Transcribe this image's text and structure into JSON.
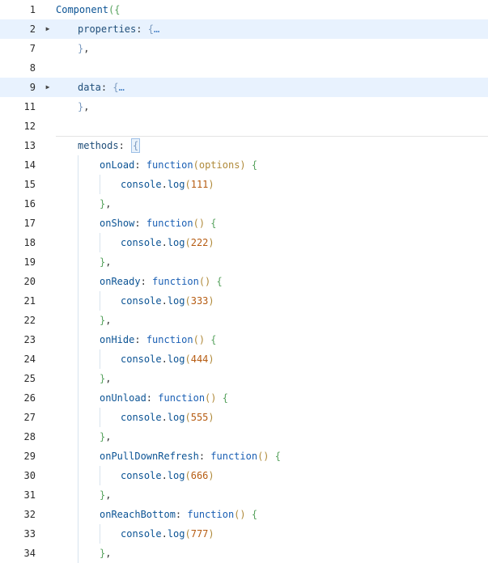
{
  "lines": [
    {
      "n": "1",
      "fold": false,
      "hl": false,
      "tokens": [
        {
          "t": "Component",
          "c": "tok-ident"
        },
        {
          "t": "({",
          "c": "tok-brace-a"
        }
      ]
    },
    {
      "n": "2",
      "fold": true,
      "hl": true,
      "indent": 1,
      "tokens": [
        {
          "t": "properties",
          "c": "tok-prop"
        },
        {
          "t": ": ",
          "c": "tok-punc"
        },
        {
          "t": "{",
          "c": "tok-brace-b"
        },
        {
          "t": "…",
          "c": "tok-ell"
        }
      ]
    },
    {
      "n": "7",
      "fold": false,
      "hl": false,
      "indent": 1,
      "tokens": [
        {
          "t": "}",
          "c": "tok-brace-b"
        },
        {
          "t": ",",
          "c": "tok-punc"
        }
      ]
    },
    {
      "n": "8",
      "fold": false,
      "hl": false,
      "tokens": []
    },
    {
      "n": "9",
      "fold": true,
      "hl": true,
      "indent": 1,
      "tokens": [
        {
          "t": "data",
          "c": "tok-prop"
        },
        {
          "t": ": ",
          "c": "tok-punc"
        },
        {
          "t": "{",
          "c": "tok-brace-b"
        },
        {
          "t": "…",
          "c": "tok-ell"
        }
      ]
    },
    {
      "n": "11",
      "fold": false,
      "hl": false,
      "indent": 1,
      "tokens": [
        {
          "t": "}",
          "c": "tok-brace-b"
        },
        {
          "t": ",",
          "c": "tok-punc"
        }
      ]
    },
    {
      "n": "12",
      "fold": false,
      "hl": false,
      "tokens": []
    },
    {
      "n": "13",
      "fold": false,
      "hl": false,
      "indent": 1,
      "tokens": [
        {
          "t": "methods",
          "c": "tok-prop"
        },
        {
          "t": ": ",
          "c": "tok-punc"
        },
        {
          "t": "{",
          "c": "tok-brace-b",
          "box": true
        }
      ]
    },
    {
      "n": "14",
      "fold": false,
      "hl": false,
      "indent": 2,
      "tokens": [
        {
          "t": "onLoad",
          "c": "tok-ident"
        },
        {
          "t": ": ",
          "c": "tok-punc"
        },
        {
          "t": "function",
          "c": "tok-kw"
        },
        {
          "t": "(",
          "c": "tok-brace-c"
        },
        {
          "t": "options",
          "c": "tok-param"
        },
        {
          "t": ")",
          "c": "tok-brace-c"
        },
        {
          "t": " {",
          "c": "tok-brace-a"
        }
      ]
    },
    {
      "n": "15",
      "fold": false,
      "hl": false,
      "indent": 3,
      "tokens": [
        {
          "t": "console",
          "c": "tok-ident"
        },
        {
          "t": ".",
          "c": "tok-punc"
        },
        {
          "t": "log",
          "c": "tok-ident"
        },
        {
          "t": "(",
          "c": "tok-brace-c"
        },
        {
          "t": "111",
          "c": "tok-num"
        },
        {
          "t": ")",
          "c": "tok-brace-c"
        }
      ]
    },
    {
      "n": "16",
      "fold": false,
      "hl": false,
      "indent": 2,
      "tokens": [
        {
          "t": "}",
          "c": "tok-brace-a"
        },
        {
          "t": ",",
          "c": "tok-punc"
        }
      ]
    },
    {
      "n": "17",
      "fold": false,
      "hl": false,
      "indent": 2,
      "tokens": [
        {
          "t": "onShow",
          "c": "tok-ident"
        },
        {
          "t": ": ",
          "c": "tok-punc"
        },
        {
          "t": "function",
          "c": "tok-kw"
        },
        {
          "t": "()",
          "c": "tok-brace-c"
        },
        {
          "t": " {",
          "c": "tok-brace-a"
        }
      ]
    },
    {
      "n": "18",
      "fold": false,
      "hl": false,
      "indent": 3,
      "tokens": [
        {
          "t": "console",
          "c": "tok-ident"
        },
        {
          "t": ".",
          "c": "tok-punc"
        },
        {
          "t": "log",
          "c": "tok-ident"
        },
        {
          "t": "(",
          "c": "tok-brace-c"
        },
        {
          "t": "222",
          "c": "tok-num"
        },
        {
          "t": ")",
          "c": "tok-brace-c"
        }
      ]
    },
    {
      "n": "19",
      "fold": false,
      "hl": false,
      "indent": 2,
      "tokens": [
        {
          "t": "}",
          "c": "tok-brace-a"
        },
        {
          "t": ",",
          "c": "tok-punc"
        }
      ]
    },
    {
      "n": "20",
      "fold": false,
      "hl": false,
      "indent": 2,
      "tokens": [
        {
          "t": "onReady",
          "c": "tok-ident"
        },
        {
          "t": ": ",
          "c": "tok-punc"
        },
        {
          "t": "function",
          "c": "tok-kw"
        },
        {
          "t": "()",
          "c": "tok-brace-c"
        },
        {
          "t": " {",
          "c": "tok-brace-a"
        }
      ]
    },
    {
      "n": "21",
      "fold": false,
      "hl": false,
      "indent": 3,
      "tokens": [
        {
          "t": "console",
          "c": "tok-ident"
        },
        {
          "t": ".",
          "c": "tok-punc"
        },
        {
          "t": "log",
          "c": "tok-ident"
        },
        {
          "t": "(",
          "c": "tok-brace-c"
        },
        {
          "t": "333",
          "c": "tok-num"
        },
        {
          "t": ")",
          "c": "tok-brace-c"
        }
      ]
    },
    {
      "n": "22",
      "fold": false,
      "hl": false,
      "indent": 2,
      "tokens": [
        {
          "t": "}",
          "c": "tok-brace-a"
        },
        {
          "t": ",",
          "c": "tok-punc"
        }
      ]
    },
    {
      "n": "23",
      "fold": false,
      "hl": false,
      "indent": 2,
      "tokens": [
        {
          "t": "onHide",
          "c": "tok-ident"
        },
        {
          "t": ": ",
          "c": "tok-punc"
        },
        {
          "t": "function",
          "c": "tok-kw"
        },
        {
          "t": "()",
          "c": "tok-brace-c"
        },
        {
          "t": " {",
          "c": "tok-brace-a"
        }
      ]
    },
    {
      "n": "24",
      "fold": false,
      "hl": false,
      "indent": 3,
      "tokens": [
        {
          "t": "console",
          "c": "tok-ident"
        },
        {
          "t": ".",
          "c": "tok-punc"
        },
        {
          "t": "log",
          "c": "tok-ident"
        },
        {
          "t": "(",
          "c": "tok-brace-c"
        },
        {
          "t": "444",
          "c": "tok-num"
        },
        {
          "t": ")",
          "c": "tok-brace-c"
        }
      ]
    },
    {
      "n": "25",
      "fold": false,
      "hl": false,
      "indent": 2,
      "tokens": [
        {
          "t": "}",
          "c": "tok-brace-a"
        },
        {
          "t": ",",
          "c": "tok-punc"
        }
      ]
    },
    {
      "n": "26",
      "fold": false,
      "hl": false,
      "indent": 2,
      "tokens": [
        {
          "t": "onUnload",
          "c": "tok-ident"
        },
        {
          "t": ": ",
          "c": "tok-punc"
        },
        {
          "t": "function",
          "c": "tok-kw"
        },
        {
          "t": "()",
          "c": "tok-brace-c"
        },
        {
          "t": " {",
          "c": "tok-brace-a"
        }
      ]
    },
    {
      "n": "27",
      "fold": false,
      "hl": false,
      "indent": 3,
      "tokens": [
        {
          "t": "console",
          "c": "tok-ident"
        },
        {
          "t": ".",
          "c": "tok-punc"
        },
        {
          "t": "log",
          "c": "tok-ident"
        },
        {
          "t": "(",
          "c": "tok-brace-c"
        },
        {
          "t": "555",
          "c": "tok-num"
        },
        {
          "t": ")",
          "c": "tok-brace-c"
        }
      ]
    },
    {
      "n": "28",
      "fold": false,
      "hl": false,
      "indent": 2,
      "tokens": [
        {
          "t": "}",
          "c": "tok-brace-a"
        },
        {
          "t": ",",
          "c": "tok-punc"
        }
      ]
    },
    {
      "n": "29",
      "fold": false,
      "hl": false,
      "indent": 2,
      "tokens": [
        {
          "t": "onPullDownRefresh",
          "c": "tok-ident"
        },
        {
          "t": ": ",
          "c": "tok-punc"
        },
        {
          "t": "function",
          "c": "tok-kw"
        },
        {
          "t": "()",
          "c": "tok-brace-c"
        },
        {
          "t": " {",
          "c": "tok-brace-a"
        }
      ]
    },
    {
      "n": "30",
      "fold": false,
      "hl": false,
      "indent": 3,
      "tokens": [
        {
          "t": "console",
          "c": "tok-ident"
        },
        {
          "t": ".",
          "c": "tok-punc"
        },
        {
          "t": "log",
          "c": "tok-ident"
        },
        {
          "t": "(",
          "c": "tok-brace-c"
        },
        {
          "t": "666",
          "c": "tok-num"
        },
        {
          "t": ")",
          "c": "tok-brace-c"
        }
      ]
    },
    {
      "n": "31",
      "fold": false,
      "hl": false,
      "indent": 2,
      "tokens": [
        {
          "t": "}",
          "c": "tok-brace-a"
        },
        {
          "t": ",",
          "c": "tok-punc"
        }
      ]
    },
    {
      "n": "32",
      "fold": false,
      "hl": false,
      "indent": 2,
      "tokens": [
        {
          "t": "onReachBottom",
          "c": "tok-ident"
        },
        {
          "t": ": ",
          "c": "tok-punc"
        },
        {
          "t": "function",
          "c": "tok-kw"
        },
        {
          "t": "()",
          "c": "tok-brace-c"
        },
        {
          "t": " {",
          "c": "tok-brace-a"
        }
      ]
    },
    {
      "n": "33",
      "fold": false,
      "hl": false,
      "indent": 3,
      "tokens": [
        {
          "t": "console",
          "c": "tok-ident"
        },
        {
          "t": ".",
          "c": "tok-punc"
        },
        {
          "t": "log",
          "c": "tok-ident"
        },
        {
          "t": "(",
          "c": "tok-brace-c"
        },
        {
          "t": "777",
          "c": "tok-num"
        },
        {
          "t": ")",
          "c": "tok-brace-c"
        }
      ]
    },
    {
      "n": "34",
      "fold": false,
      "hl": false,
      "indent": 2,
      "tokens": [
        {
          "t": "}",
          "c": "tok-brace-a"
        },
        {
          "t": ",",
          "c": "tok-punc"
        }
      ]
    }
  ],
  "fold_icon": "triangle-right-icon"
}
